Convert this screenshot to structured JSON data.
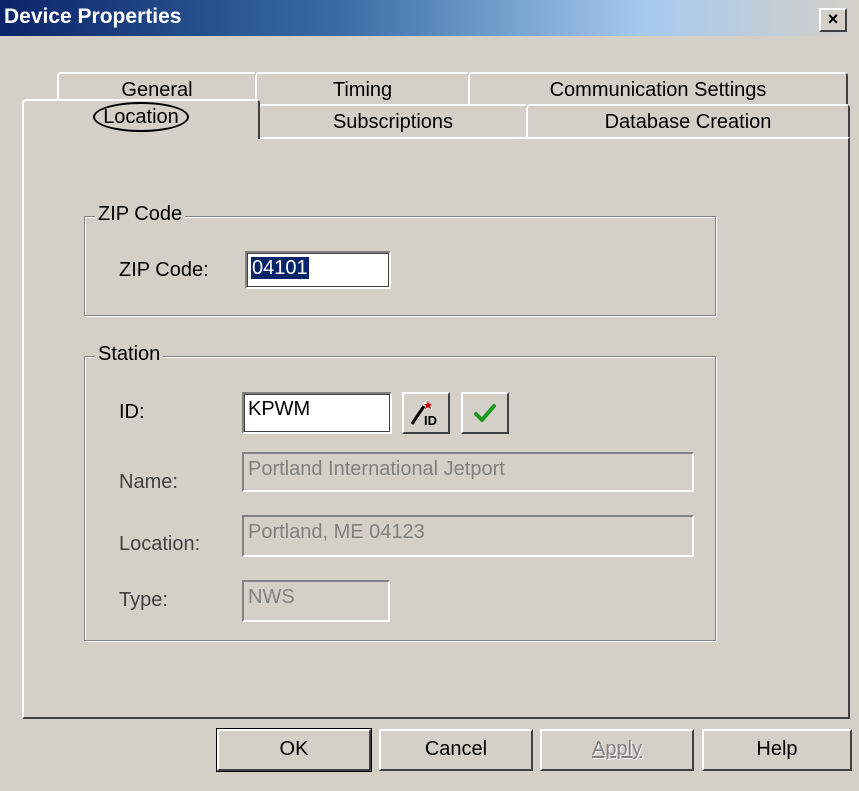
{
  "window": {
    "title": "Device Properties",
    "close_glyph": "×"
  },
  "tabs": {
    "row1": [
      {
        "label": "General"
      },
      {
        "label": "Timing"
      },
      {
        "label": "Communication Settings"
      }
    ],
    "row2": [
      {
        "label": "Location",
        "active": true
      },
      {
        "label": "Subscriptions"
      },
      {
        "label": "Database Creation"
      }
    ]
  },
  "zip_group": {
    "title": "ZIP Code",
    "label": "ZIP Code:",
    "value": "04101"
  },
  "station_group": {
    "title": "Station",
    "id_label": "ID:",
    "id_value": "KPWM",
    "id_wizard_icon": "magic-wand-id-icon",
    "verify_icon": "checkmark-icon",
    "name_label": "Name:",
    "name_value": "Portland International Jetport",
    "location_label": "Location:",
    "location_value": "Portland, ME 04123",
    "type_label": "Type:",
    "type_value": "NWS"
  },
  "buttons": {
    "ok": "OK",
    "cancel": "Cancel",
    "apply": "Apply",
    "help": "Help"
  },
  "colors": {
    "titlebar": "#0a246a",
    "selection": "#0a246a",
    "checkmark": "#1a9a1a",
    "face": "#d4d0c8"
  }
}
